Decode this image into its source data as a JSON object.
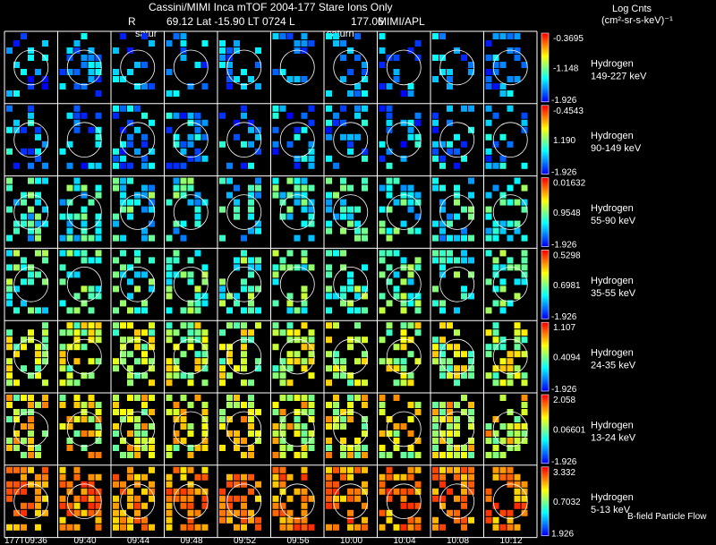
{
  "header": {
    "title": "Cassini/MIMI Inca mTOF  2004-177    Stare    Ions Only",
    "sub_r": "R",
    "sub_pos": "69.12 Lat -15.90 LT 0724 L",
    "sub_l": "177.06",
    "sub_inst": "MIMI/APL",
    "saturn_label_1": "satur",
    "saturn_label_2": "saturn"
  },
  "units": {
    "line1": "Log Cnts",
    "line2": "(cm²-sr-s-keV)⁻¹"
  },
  "footer": {
    "bfield_label": "B-field  Particle Flow"
  },
  "colors": {
    "background": "#000000",
    "grid": "#ffffff",
    "scale": [
      "#0000ff",
      "#0080ff",
      "#00ffff",
      "#80ff80",
      "#ffff00",
      "#ff8000",
      "#ff0000"
    ]
  },
  "chart_data": {
    "type": "heatmap",
    "x_tick_labels": [
      "177T09:36",
      "09:40",
      "09:44",
      "09:48",
      "09:52",
      "09:56",
      "10:00",
      "10:04",
      "10:08",
      "10:12"
    ],
    "channels": [
      {
        "species": "Hydrogen",
        "energy": "149-227 keV",
        "cb_max": "-0.3695",
        "cb_mid": "-1.148",
        "cb_min": "-1.926",
        "level_range": [
          0.0,
          0.35
        ]
      },
      {
        "species": "Hydrogen",
        "energy": "90-149 keV",
        "cb_max": "-0.4543",
        "cb_mid": "1.190",
        "cb_min": "-1.926",
        "level_range": [
          0.0,
          0.4
        ]
      },
      {
        "species": "Hydrogen",
        "energy": "55-90 keV",
        "cb_max": "0.01632",
        "cb_mid": "0.9548",
        "cb_min": "-1.926",
        "level_range": [
          0.15,
          0.55
        ]
      },
      {
        "species": "Hydrogen",
        "energy": "35-55 keV",
        "cb_max": "0.5298",
        "cb_mid": "0.6981",
        "cb_min": "-1.926",
        "level_range": [
          0.25,
          0.6
        ]
      },
      {
        "species": "Hydrogen",
        "energy": "24-35 keV",
        "cb_max": "1.107",
        "cb_mid": "0.4094",
        "cb_min": "-1.926",
        "level_range": [
          0.4,
          0.75
        ]
      },
      {
        "species": "Hydrogen",
        "energy": "13-24 keV",
        "cb_max": "2.058",
        "cb_mid": "0.06601",
        "cb_min": "-1.926",
        "level_range": [
          0.45,
          0.85
        ]
      },
      {
        "species": "Hydrogen",
        "energy": "5-13 keV",
        "cb_max": "3.332",
        "cb_mid": "0.7032",
        "cb_min": "1.926",
        "level_range": [
          0.7,
          0.95
        ]
      }
    ]
  }
}
